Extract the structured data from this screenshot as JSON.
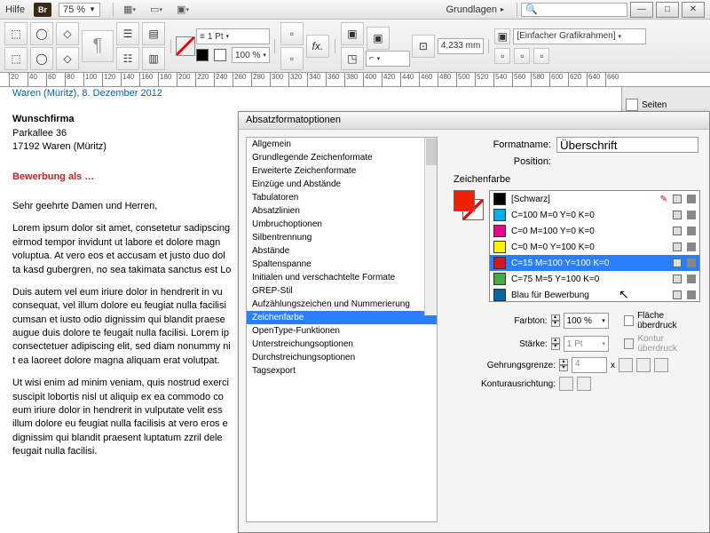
{
  "menubar": {
    "help": "Hilfe",
    "br": "Br",
    "zoom": "75 %",
    "mode": "Grundlagen"
  },
  "toolbar": {
    "stroke": "1 Pt",
    "pct": "100 %",
    "mm": "4,233 mm",
    "frame": "[Einfacher Grafikrahmen]"
  },
  "sidepanel": {
    "title": "Seiten"
  },
  "document": {
    "date": "Waren (Müritz), 8. Dezember 2012",
    "firm": "Wunschfirma",
    "addr1": "Parkallee 36",
    "addr2": "17192 Waren (Müritz)",
    "heading": "Bewerbung als …",
    "salut": "Sehr geehrte Damen und Herren,",
    "p1": "Lorem ipsum dolor sit amet, consetetur sadipscing eirmod tempor invidunt ut labore et dolore magn voluptua. At vero eos et accusam et justo duo dol ta kasd gubergren, no sea takimata sanctus est Lo",
    "p2": "Duis autem vel eum iriure dolor in hendrerit in vu consequat, vel illum dolore eu feugiat nulla facilisi cumsan et iusto odio dignissim qui blandit praese augue duis dolore te feugait nulla facilisi. Lorem ip consectetuer adipiscing elit, sed diam nonummy ni t ea laoreet dolore magna aliquam erat volutpat.",
    "p3": "Ut wisi enim ad minim veniam, quis nostrud exerci suscipit lobortis nisl ut aliquip ex ea commodo co eum iriure dolor in hendrerit in vulputate velit ess illum dolore eu feugiat nulla facilisis at vero eros e dignissim qui blandit praesent luptatum zzril dele feugait nulla facilisi."
  },
  "dialog": {
    "title": "Absatzformatoptionen",
    "categories": [
      "Allgemein",
      "Grundlegende Zeichenformate",
      "Erweiterte Zeichenformate",
      "Einzüge und Abstände",
      "Tabulatoren",
      "Absatzlinien",
      "Umbruchoptionen",
      "Silbentrennung",
      "Abstände",
      "Spaltenspanne",
      "Initialen und verschachtelte Formate",
      "GREP-Stil",
      "Aufzählungszeichen und Nummerierung",
      "Zeichenfarbe",
      "OpenType-Funktionen",
      "Unterstreichungsoptionen",
      "Durchstreichungsoptionen",
      "Tagsexport"
    ],
    "selected_index": 13,
    "formatname_label": "Formatname:",
    "formatname_value": "Überschrift",
    "position_label": "Position:",
    "section": "Zeichenfarbe",
    "colors": [
      {
        "label": "[Schwarz]",
        "hex": "#000000"
      },
      {
        "label": "C=100 M=0 Y=0 K=0",
        "hex": "#00aeef"
      },
      {
        "label": "C=0 M=100 Y=0 K=0",
        "hex": "#ec008c"
      },
      {
        "label": "C=0 M=0 Y=100 K=0",
        "hex": "#fff200"
      },
      {
        "label": "C=15 M=100 Y=100 K=0",
        "hex": "#cf1920"
      },
      {
        "label": "C=75 M=5 Y=100 K=0",
        "hex": "#3fae49"
      },
      {
        "label": "Blau für Bewerbung",
        "hex": "#0066a8"
      }
    ],
    "color_selected": 4,
    "farbton_label": "Farbton:",
    "farbton_value": "100 %",
    "staerke_label": "Stärke:",
    "staerke_value": "1 Pt",
    "gehrung_label": "Gehrungsgrenze:",
    "gehrung_value": "4",
    "gehrung_x": "x",
    "kontur_label": "Konturausrichtung:",
    "flaeche": "Fläche überdruck",
    "kontur_over": "Kontur überdruck"
  },
  "ruler_marks": [
    20,
    40,
    60,
    80,
    100,
    120,
    140,
    160,
    180,
    200,
    220,
    240,
    260,
    280,
    300,
    320,
    340,
    360,
    380,
    400,
    420,
    440,
    460,
    480,
    500,
    520,
    540,
    560,
    580,
    600,
    620,
    640,
    660
  ]
}
